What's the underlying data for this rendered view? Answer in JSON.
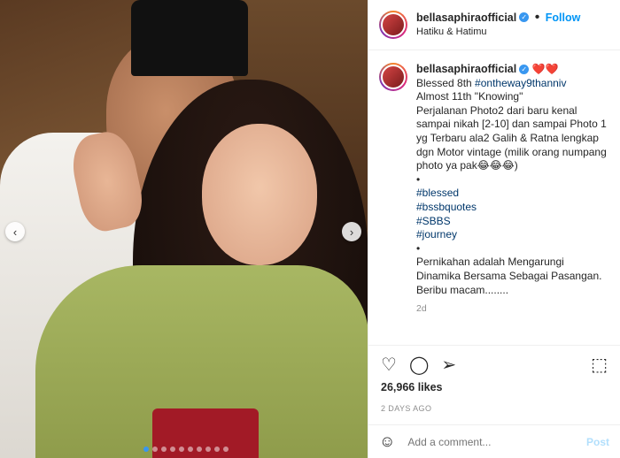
{
  "header": {
    "username": "bellasaphiraofficial",
    "follow": "Follow",
    "location": "Hatiku & Hatimu",
    "separator": "•"
  },
  "caption": {
    "username": "bellasaphiraofficial",
    "hearts": "❤️❤️",
    "line1_prefix": "Blessed 8th ",
    "line1_tag": "#ontheway9thanniv",
    "line2": "Almost 11th \"Knowing\"",
    "body": "Perjalanan Photo2 dari baru kenal sampai nikah [2-10] dan sampai Photo 1 yg Terbaru ala2 Galih & Ratna lengkap dgn Motor vintage (milik orang numpang photo ya pak",
    "body_end": "😂😂😂)",
    "bullet": "•",
    "tags": [
      "#blessed",
      "#bssbquotes",
      "#SBBS",
      "#journey"
    ],
    "bullet2": "•",
    "closing": "Pernikahan adalah Mengarungi Dinamika Bersama Sebagai Pasangan. Beribu macam........",
    "time": "2d"
  },
  "actions": {
    "like_icon": "heart-icon",
    "comment_icon": "comment-icon",
    "share_icon": "share-icon",
    "save_icon": "bookmark-icon"
  },
  "likes": "26,966 likes",
  "date": "2 DAYS AGO",
  "comment": {
    "placeholder": "Add a comment...",
    "post": "Post"
  },
  "carousel": {
    "slides": 10,
    "active": 1
  }
}
